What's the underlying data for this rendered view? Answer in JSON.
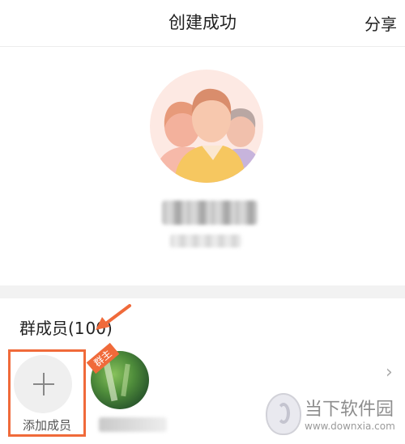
{
  "header": {
    "title": "创建成功",
    "share_label": "分享"
  },
  "group": {
    "avatar_icon": "group-avatar-icon"
  },
  "members": {
    "title": "群成员(1",
    "count": "00)",
    "add_label": "添加成员",
    "owner_badge": "群主"
  },
  "watermark": {
    "title": "当下软件园",
    "url": "www.downxia.com"
  },
  "colors": {
    "accent": "#f06a3a",
    "divider": "#f2f2f2",
    "avatar_bg": "#fde9e3"
  },
  "icons": {
    "add": "plus-icon",
    "chevron": "chevron-right-icon",
    "arrow": "annotation-arrow-icon"
  }
}
